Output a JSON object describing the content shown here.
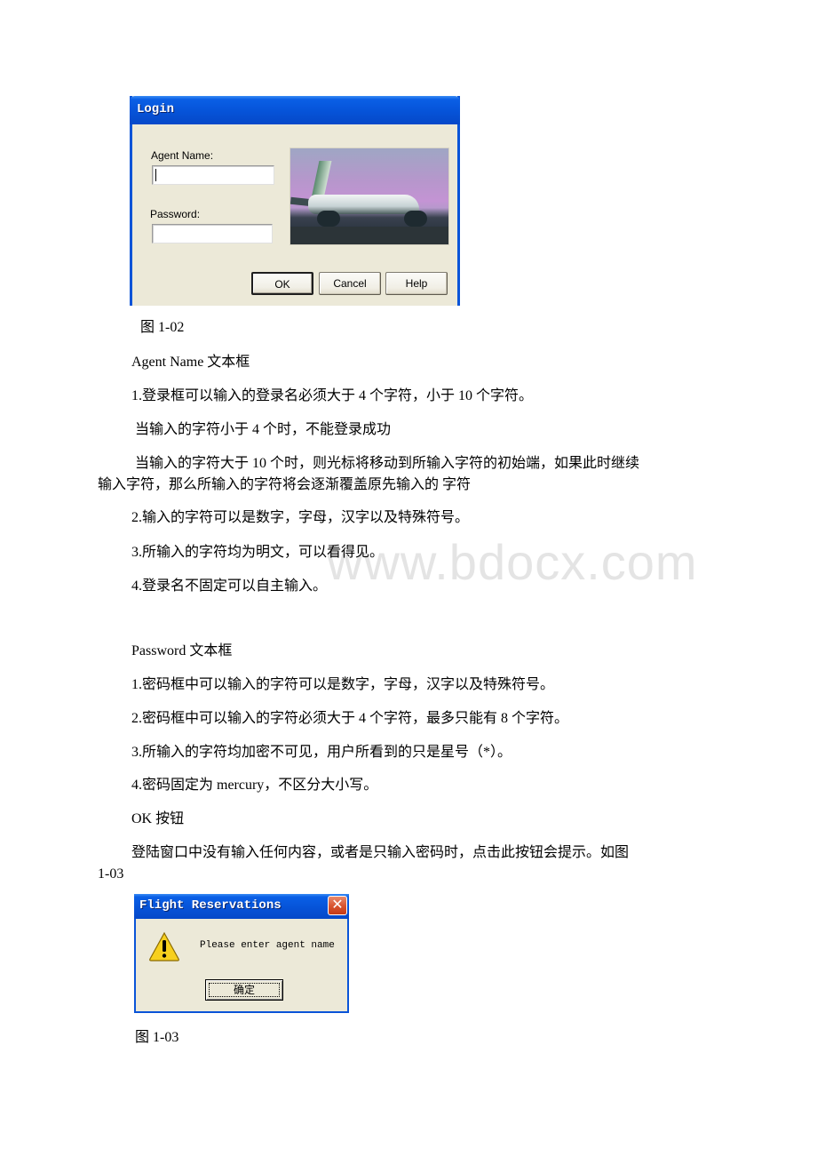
{
  "login_dialog": {
    "title": "Login",
    "agent_name_label": "Agent Name:",
    "agent_name_value": "",
    "password_label": "Password:",
    "password_value": "",
    "image_icon": "airplane-photo",
    "buttons": {
      "ok": "OK",
      "cancel": "Cancel",
      "help": "Help"
    },
    "title_bar_color": "#0653d8",
    "body_color": "#ece9d8"
  },
  "caption_1": "图 1-02",
  "sections": {
    "agent_name": {
      "heading": "Agent Name 文本框",
      "items": [
        "1.登录框可以输入的登录名必须大于 4 个字符，小于 10 个字符。",
        "当输入的字符小于 4 个时，不能登录成功",
        "当输入的字符大于 10 个时，则光标将移动到所输入字符的初始端，如果此时继续",
        "输入字符，那么所输入的字符将会逐渐覆盖原先输入的 字符",
        "2.输入的字符可以是数字，字母，汉字以及特殊符号。",
        "3.所输入的字符均为明文，可以看得见。",
        "4.登录名不固定可以自主输入。"
      ]
    },
    "password": {
      "heading": "Password 文本框",
      "items": [
        "1.密码框中可以输入的字符可以是数字，字母，汉字以及特殊符号。",
        "2.密码框中可以输入的字符必须大于 4 个字符，最多只能有 8 个字符。",
        "3.所输入的字符均加密不可见，用户所看到的只是星号（*）。",
        "4.密码固定为 mercury，不区分大小写。"
      ]
    },
    "ok_button": {
      "heading": "OK 按钮",
      "items": [
        "登陆窗口中没有输入任何内容，或者是只输入密码时，点击此按钮会提示。如图",
        "1-03"
      ]
    }
  },
  "message_dialog": {
    "title": "Flight Reservations",
    "close_icon": "close-icon",
    "warning_icon": "warning-icon",
    "message": "Please enter agent name",
    "ok_button": "确定"
  },
  "caption_2": "图 1-03",
  "watermark": "www.bdocx.com"
}
